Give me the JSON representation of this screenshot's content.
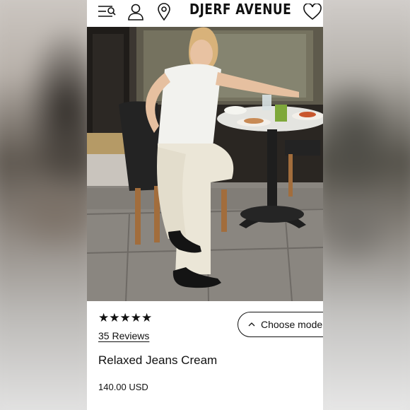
{
  "header": {
    "brand": "DJERF AVENUE",
    "icons": [
      "menu-search-icon",
      "account-icon",
      "location-pin-icon",
      "wishlist-heart-icon"
    ]
  },
  "hero": {
    "alt": "Model wearing cream relaxed jeans seated at cafe table"
  },
  "product": {
    "rating_stars": "★★★★★",
    "rating_value": 5,
    "reviews_label": "35 Reviews",
    "choose_label": "Choose mode",
    "title": "Relaxed Jeans Cream",
    "price": "140.00 USD"
  },
  "colors": {
    "text": "#111111",
    "background": "#ffffff"
  }
}
